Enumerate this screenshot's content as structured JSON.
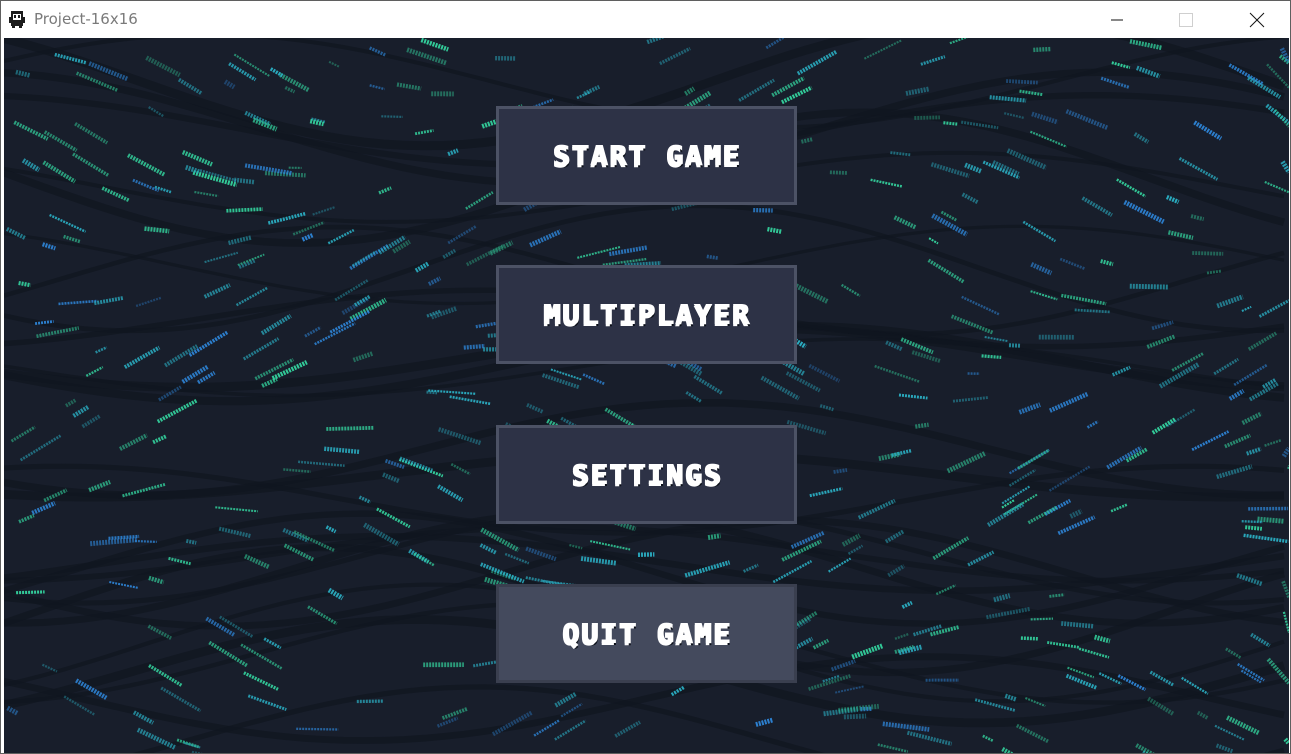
{
  "window": {
    "title": "Project-16x16",
    "controls": {
      "minimize_icon": "minimize-icon",
      "maximize_icon": "maximize-icon",
      "close_icon": "close-icon"
    }
  },
  "colors": {
    "background": "#181e2b",
    "button_fill": "#2d3246",
    "button_fill_hover": "#444a5d",
    "button_border": "#4c5265",
    "button_text": "#ffffff",
    "streak_green": "#34d6a0",
    "streak_cyan": "#2bb3c8",
    "streak_blue": "#2e86d9"
  },
  "menu": {
    "buttons": [
      {
        "label": "START GAME",
        "hovered": false
      },
      {
        "label": "MULTIPLAYER",
        "hovered": false
      },
      {
        "label": "SETTINGS",
        "hovered": false
      },
      {
        "label": "QUIT GAME",
        "hovered": true
      }
    ]
  }
}
